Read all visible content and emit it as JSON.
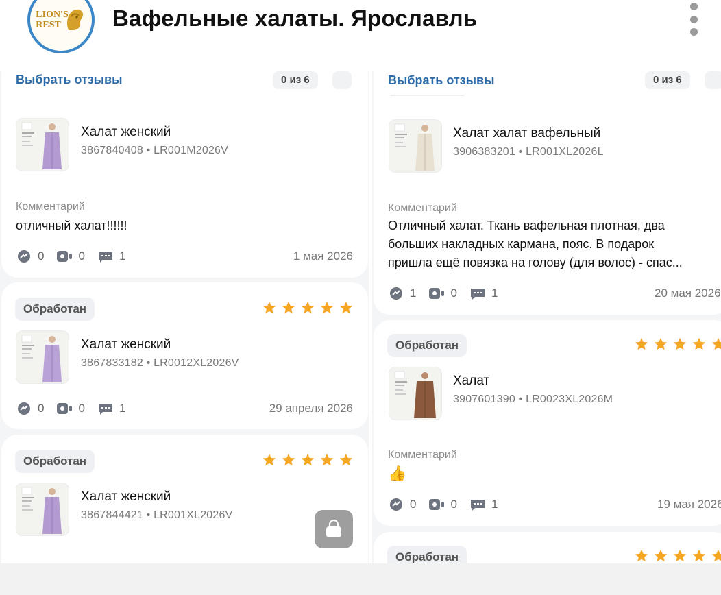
{
  "header": {
    "title": "Вафельные халаты. Ярославль",
    "logo_text_line1": "LION'S",
    "logo_text_line2": "REST"
  },
  "left_column": {
    "select_link": "Выбрать отзывы",
    "counter": "0 из 6",
    "cards": [
      {
        "status": "",
        "product_name": "Халат женский",
        "product_meta": "3867840408 • LR001M2026V",
        "comment_label": "Комментарий",
        "comment_lines": [
          "отличный халат!!!!!!"
        ],
        "likes": "0",
        "videos": "0",
        "comments": "1",
        "date": "1 мая 2026"
      },
      {
        "status": "Обработан",
        "rating": 5,
        "product_name": "Халат женский",
        "product_meta": "3867833182 • LR0012XL2026V",
        "likes": "0",
        "videos": "0",
        "comments": "1",
        "date": "29 апреля 2026"
      },
      {
        "status": "Обработан",
        "rating": 5,
        "product_name": "Халат женский",
        "product_meta": "3867844421 • LR001XL2026V"
      }
    ]
  },
  "right_column": {
    "select_link": "Выбрать отзывы",
    "counter": "0 из 6",
    "cards": [
      {
        "product_name": "Халат халат вафельный",
        "product_meta": "3906383201 • LR001XL2026L",
        "comment_label": "Комментарий",
        "comment_lines": [
          "Отличный халат. Ткань вафельная плотная, два",
          "больших накладных кармана, пояс. В подарок",
          "пришла ещё повязка на голову (для волос) - спас..."
        ],
        "likes": "1",
        "videos": "0",
        "comments": "1",
        "date": "20 мая 2026"
      },
      {
        "status": "Обработан",
        "rating": 5,
        "product_name": "Халат",
        "product_meta": "3907601390 • LR0023XL2026M",
        "comment_label": "Комментарий",
        "comment_emoji": "👍",
        "likes": "0",
        "videos": "0",
        "comments": "1",
        "date": "19 мая 2026"
      },
      {
        "status": "Обработан",
        "rating": 5
      }
    ]
  },
  "colors": {
    "accent_link": "#2d6aa8",
    "star": "#f5a623",
    "fab": "#9e9e9e"
  },
  "icons": [
    "kebab-menu-icon",
    "dislike-icon",
    "video-icon",
    "comment-icon",
    "star-icon",
    "shopping-bag-icon"
  ]
}
